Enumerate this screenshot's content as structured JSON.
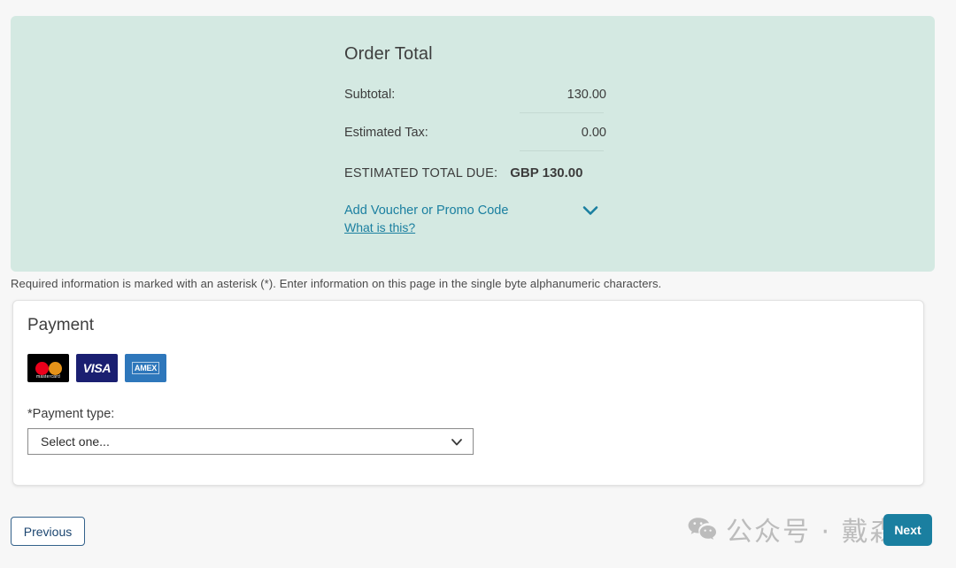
{
  "order": {
    "title": "Order Total",
    "rows": [
      {
        "label": "Subtotal:",
        "value": "130.00"
      },
      {
        "label": "Estimated Tax:",
        "value": "0.00"
      }
    ],
    "grand_label": "ESTIMATED TOTAL DUE:",
    "grand_value": "GBP 130.00",
    "voucher_link": "Add Voucher or Promo Code",
    "voucher_help": "What is this?",
    "voucher_chevron_icon": "chevron-down-icon",
    "panel_color": "#d4e9e2",
    "link_color": "#1a7fa0"
  },
  "required_note": "Required information is marked with an asterisk (*). Enter information on this page in the single byte alphanumeric characters.",
  "payment": {
    "title": "Payment",
    "cards": [
      {
        "name": "mastercard-logo",
        "label": "mastercard",
        "bg": "#000000"
      },
      {
        "name": "visa-logo",
        "label": "VISA",
        "bg": "#1a1f71"
      },
      {
        "name": "amex-logo",
        "label": "AMEX",
        "bg": "#2e77bb"
      }
    ],
    "type_label": "*Payment type:",
    "type_value": "Select one...",
    "type_options": [
      "Select one..."
    ],
    "select_chevron_icon": "chevron-down-icon"
  },
  "footer": {
    "previous_label": "Previous",
    "next_label": "Next",
    "next_color": "#1a7fa0"
  },
  "watermark": {
    "icon": "wechat-icon",
    "text": "公众号 · 戴森云",
    "color": "#bcbcbc"
  }
}
